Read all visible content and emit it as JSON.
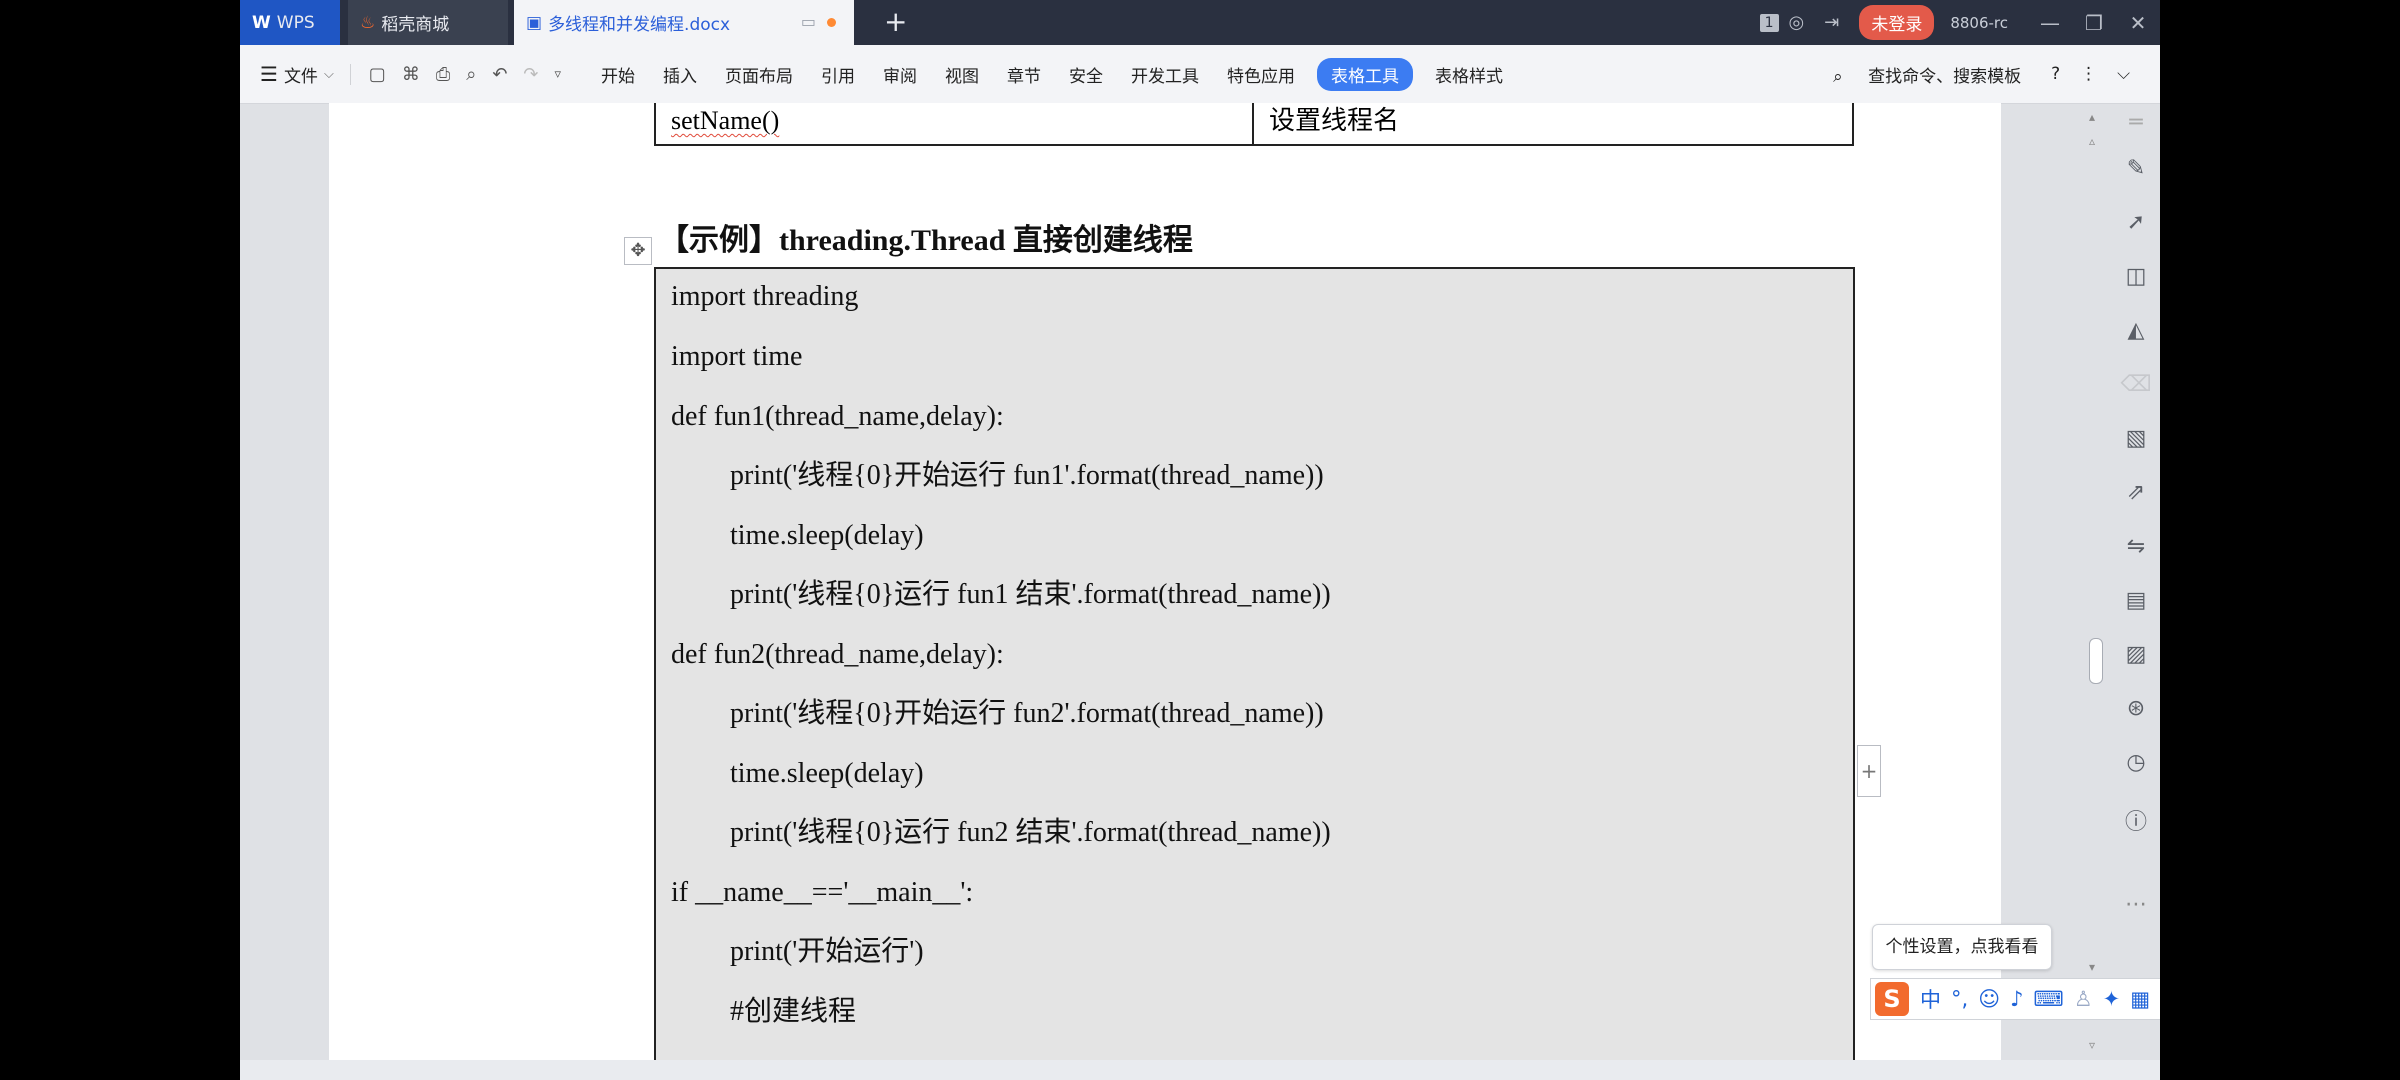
{
  "tabs": {
    "wps": "WPS",
    "daoke": "稻壳商城",
    "doc": "多线程和并发编程.docx"
  },
  "titlebar": {
    "badge": "1",
    "login": "未登录",
    "user_id": "8806-rc"
  },
  "menu": {
    "file": "文件",
    "items": [
      "开始",
      "插入",
      "页面布局",
      "引用",
      "审阅",
      "视图",
      "章节",
      "安全",
      "开发工具",
      "特色应用",
      "表格工具",
      "表格样式"
    ],
    "search": "查找命令、搜索模板"
  },
  "doc": {
    "table_row": [
      "setName()",
      "设置线程名"
    ],
    "heading": "【示例】threading.Thread 直接创建线程",
    "code": [
      {
        "text": "import threading",
        "indent": false
      },
      {
        "text": "import time",
        "indent": false
      },
      {
        "text": "def fun1(thread_name,delay):",
        "indent": false
      },
      {
        "text": "print('线程{0}开始运行 fun1'.format(thread_name))",
        "indent": true
      },
      {
        "text": "time.sleep(delay)",
        "indent": true
      },
      {
        "text": "print('线程{0}运行 fun1 结束'.format(thread_name))",
        "indent": true
      },
      {
        "text": "def fun2(thread_name,delay):",
        "indent": false
      },
      {
        "text": "print('线程{0}开始运行 fun2'.format(thread_name))",
        "indent": true
      },
      {
        "text": "time.sleep(delay)",
        "indent": true
      },
      {
        "text": "print('线程{0}运行 fun2 结束'.format(thread_name))",
        "indent": true
      },
      {
        "text": "if __name__=='__main__':",
        "indent": false
      },
      {
        "text": "print('开始运行')",
        "indent": true
      },
      {
        "text": "#创建线程",
        "indent": true
      }
    ]
  },
  "ime": {
    "tooltip": "个性设置，点我看看",
    "chinese_mode": "中"
  }
}
